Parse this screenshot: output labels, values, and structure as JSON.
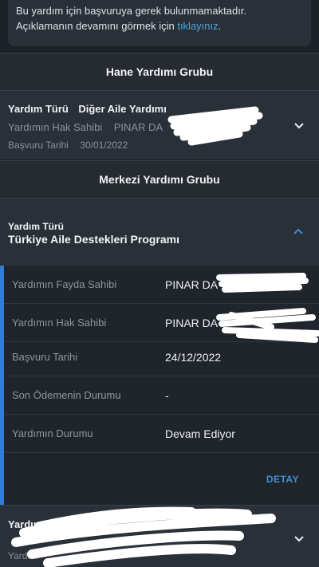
{
  "notice": {
    "line1": "Bu yardım için başvuruya gerek bulunmamaktadır.",
    "line2_prefix": "Açıklamanın devamını görmek için",
    "link": "tıklayınız",
    "line2_suffix": "."
  },
  "groups": {
    "hane_title": "Hane Yardımı Grubu",
    "merkezi_title": "Merkezi Yardımı Grubu"
  },
  "card1": {
    "type_label": "Yardım Türü",
    "type_value": "Diğer Aile Yardımı",
    "owner_label": "Yardımın Hak Sahibi",
    "owner_value": "PINAR DA",
    "date_label": "Başvuru Tarihi",
    "date_value": "30/01/2022"
  },
  "card2": {
    "type_label": "Yardım Türü",
    "type_value": "Türkiye Aile Destekleri Programı"
  },
  "details": {
    "rows": [
      {
        "label": "Yardımın Fayda Sahibi",
        "value": "PINAR DA"
      },
      {
        "label": "Yardımın Hak Sahibi",
        "value": "PINAR DA"
      },
      {
        "label": "Başvuru Tarihi",
        "value": "24/12/2022"
      },
      {
        "label": "Son Ödemenin Durumu",
        "value": "-"
      },
      {
        "label": "Yardımın Durumu",
        "value": "Devam Ediyor"
      }
    ],
    "button": "DETAY"
  },
  "card3": {
    "type_label": "Yardım Türü",
    "owner_label": "Yardım"
  },
  "colors": {
    "accent": "#2f7fd6",
    "link": "#4aa3df",
    "background": "#1c2126"
  }
}
